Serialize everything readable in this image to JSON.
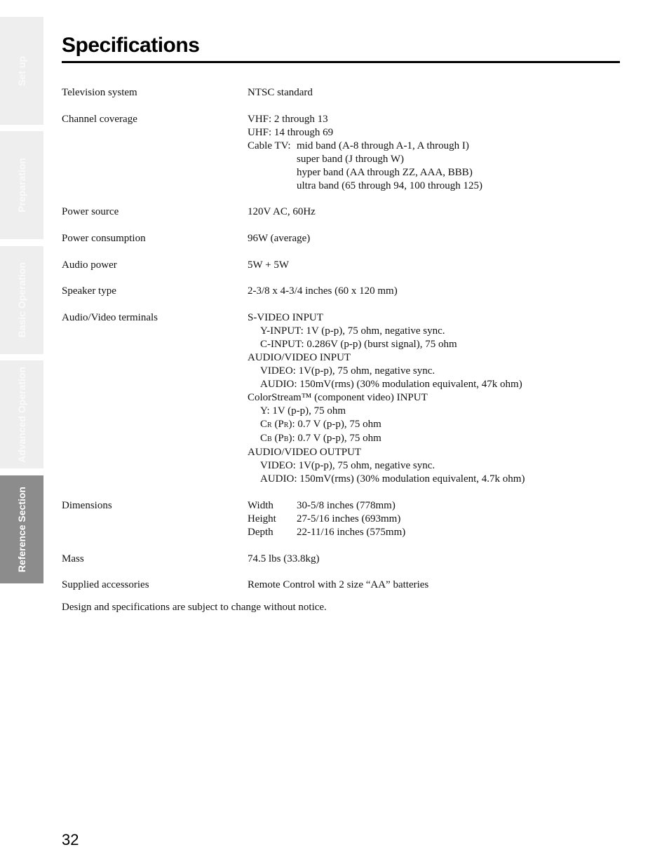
{
  "sidebar": {
    "tabs": [
      {
        "label": "Set up",
        "active": false
      },
      {
        "label": "Preparation",
        "active": false
      },
      {
        "label": "Basic Operation",
        "active": false
      },
      {
        "label": "Advanced Operation",
        "active": false
      },
      {
        "label": "Reference Section",
        "active": true
      }
    ]
  },
  "page": {
    "title": "Specifications",
    "number": "32",
    "note": "Design and specifications are subject to change without notice."
  },
  "specs": {
    "television_system": {
      "label": "Television system",
      "value": "NTSC standard"
    },
    "channel_coverage": {
      "label": "Channel coverage",
      "vhf": "VHF: 2 through 13",
      "uhf": "UHF: 14 through 69",
      "cable_lead": "Cable TV:",
      "cable_bands": [
        "mid band (A-8 through A-1, A through I)",
        "super band (J through W)",
        "hyper band (AA through ZZ, AAA, BBB)",
        "ultra band (65 through 94, 100 through 125)"
      ]
    },
    "power_source": {
      "label": "Power source",
      "value": "120V AC, 60Hz"
    },
    "power_consumption": {
      "label": "Power consumption",
      "value": "96W (average)"
    },
    "audio_power": {
      "label": "Audio power",
      "value": "5W + 5W"
    },
    "speaker_type": {
      "label": "Speaker type",
      "value": "2-3/8 x 4-3/4 inches (60 x 120 mm)"
    },
    "av_terminals": {
      "label": "Audio/Video terminals",
      "svideo_heading": "S-VIDEO INPUT",
      "svideo_y": "Y-INPUT: 1V (p-p), 75 ohm, negative sync.",
      "svideo_c": "C-INPUT: 0.286V (p-p) (burst signal), 75 ohm",
      "av_in_heading": "AUDIO/VIDEO INPUT",
      "av_in_video": "VIDEO: 1V(p-p), 75 ohm, negative sync.",
      "av_in_audio": "AUDIO: 150mV(rms) (30% modulation equivalent, 47k ohm)",
      "colorstream_heading": "ColorStream™ (component video) INPUT",
      "colorstream_y": "Y: 1V (p-p), 75 ohm",
      "cr_c": "C",
      "cr_sub": "R",
      "cr_open": " (P",
      "cr_sub2": "R",
      "cr_rest": "): 0.7 V (p-p), 75 ohm",
      "cb_c": "C",
      "cb_sub": "B",
      "cb_open": " (P",
      "cb_sub2": "B",
      "cb_rest": "): 0.7 V (p-p), 75 ohm",
      "av_out_heading": "AUDIO/VIDEO OUTPUT",
      "av_out_video": "VIDEO: 1V(p-p), 75 ohm, negative sync.",
      "av_out_audio": "AUDIO: 150mV(rms) (30% modulation equivalent, 4.7k ohm)"
    },
    "dimensions": {
      "label": "Dimensions",
      "items": [
        {
          "key": "Width",
          "value": "30-5/8 inches (778mm)"
        },
        {
          "key": "Height",
          "value": "27-5/16 inches (693mm)"
        },
        {
          "key": "Depth",
          "value": "22-11/16 inches (575mm)"
        }
      ]
    },
    "mass": {
      "label": "Mass",
      "value": "74.5 lbs (33.8kg)"
    },
    "supplied_accessories": {
      "label": "Supplied accessories",
      "value": "Remote Control with 2 size “AA” batteries"
    }
  }
}
